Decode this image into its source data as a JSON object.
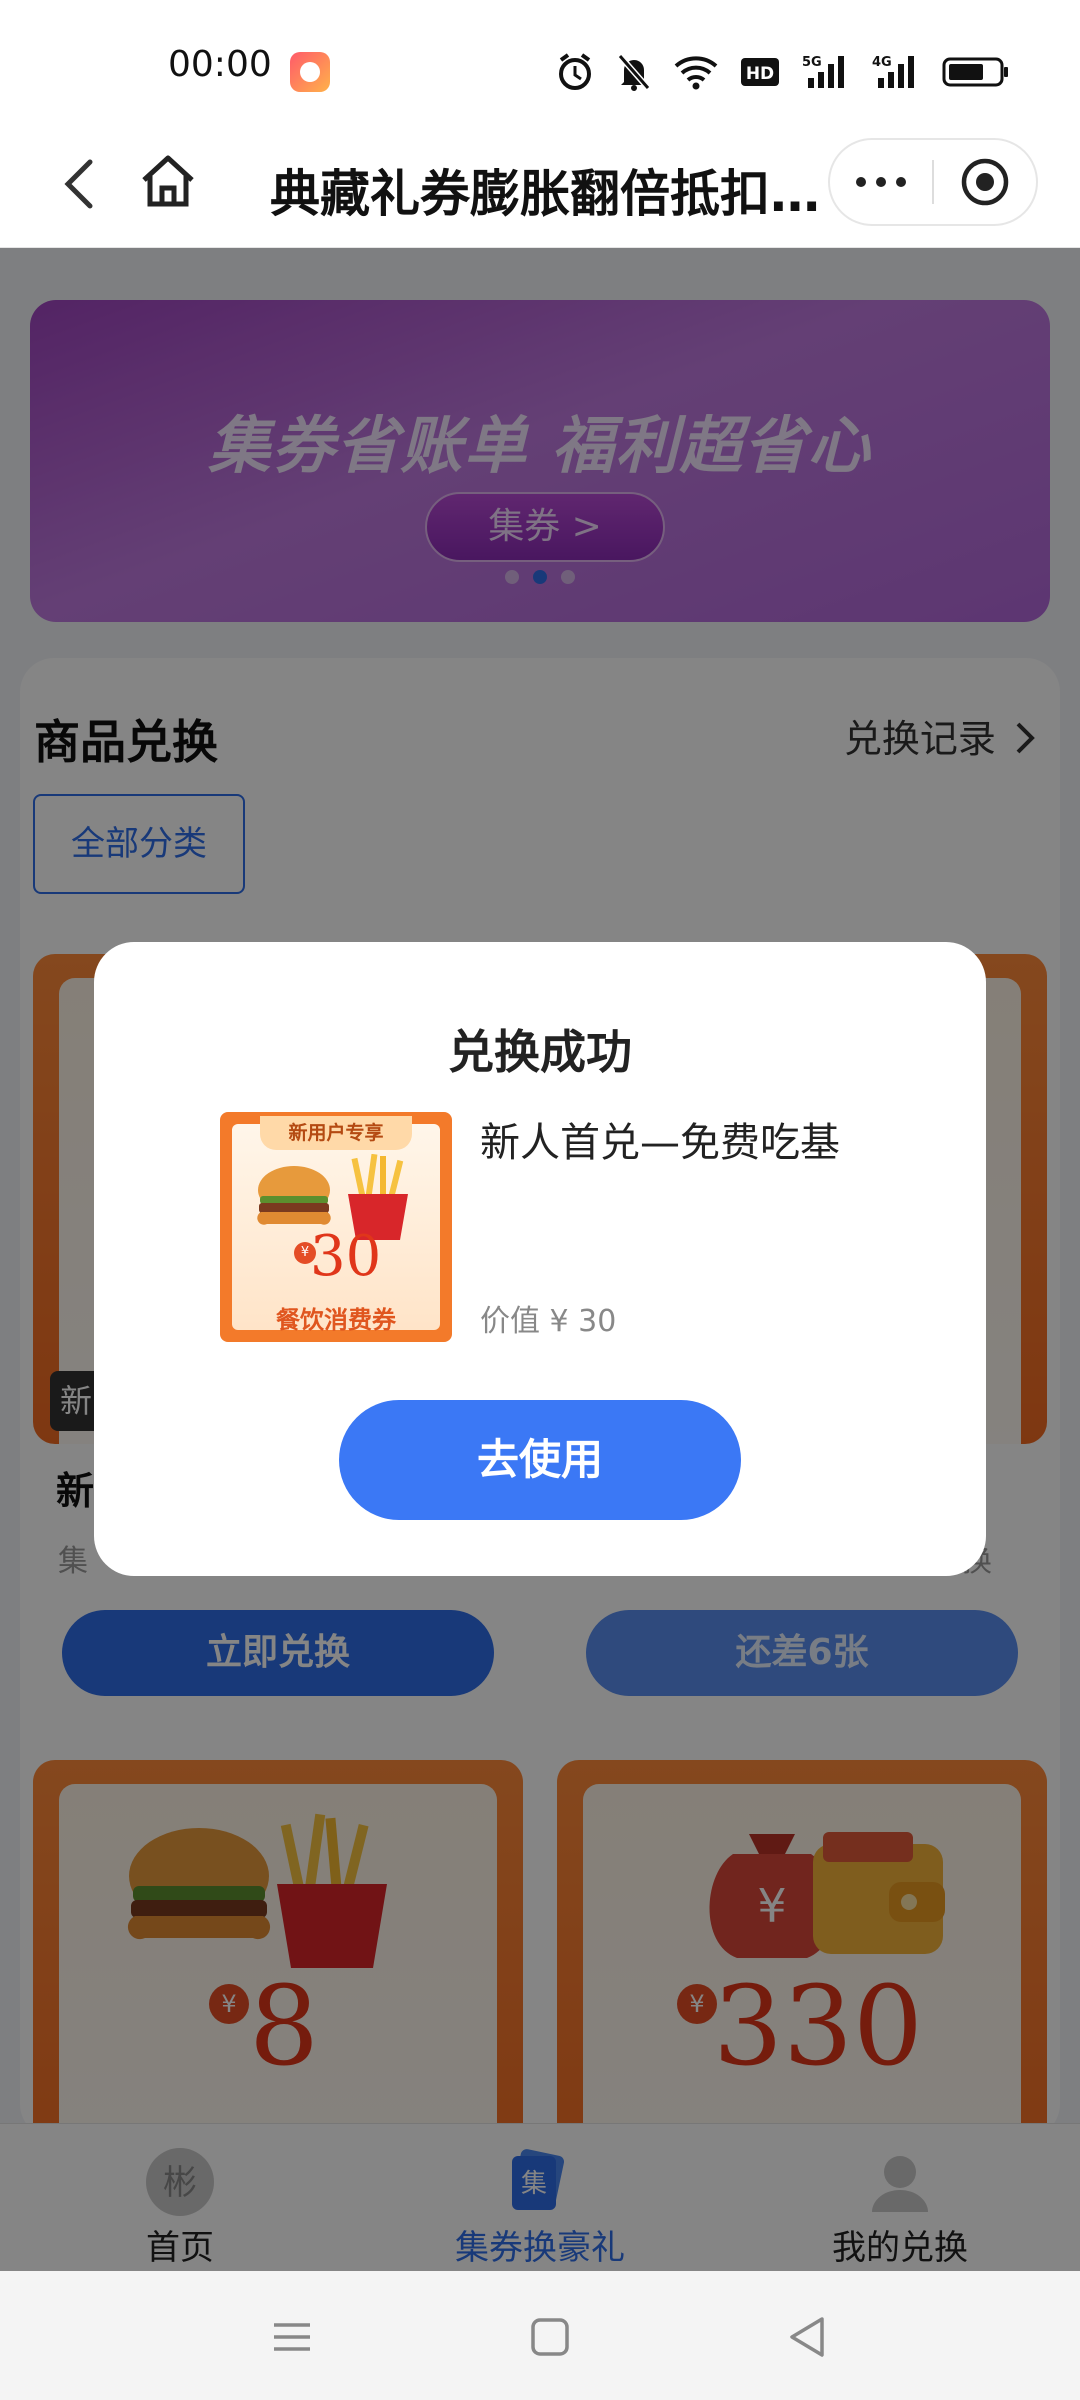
{
  "status_bar": {
    "time": "00:00",
    "icons": [
      "alarm-icon",
      "mute-icon",
      "wifi-icon",
      "hd-icon",
      "5g-signal-icon",
      "4g-signal-icon",
      "battery-icon"
    ],
    "hd_label": "HD",
    "net1": "5G",
    "net2": "4G"
  },
  "nav": {
    "title": "典藏礼券膨胀翻倍抵扣..."
  },
  "banner": {
    "slogan": "集券省账单 福利超省心",
    "button": "集券 >"
  },
  "section": {
    "title": "商品兑换",
    "record_link": "兑换记录",
    "category_button": "全部分类"
  },
  "cards": {
    "left_top": {
      "tag": "新",
      "name": "新",
      "sub": "集",
      "button": "立即兑换"
    },
    "right_top": {
      "sub": "换",
      "button": "还差6张"
    },
    "left_bottom": {
      "price": "8",
      "yen": "¥"
    },
    "right_bottom": {
      "price": "330",
      "yen": "¥"
    }
  },
  "tabs": [
    {
      "label": "首页",
      "icon": "home-tab-icon",
      "badge": "彬"
    },
    {
      "label": "集券换豪礼",
      "icon": "coupon-tab-icon",
      "badge": "集"
    },
    {
      "label": "我的兑换",
      "icon": "user-tab-icon"
    }
  ],
  "modal": {
    "title": "兑换成功",
    "product_name": "新人首兑—免费吃基",
    "value": "价值 ¥ 30",
    "button": "去使用",
    "thumb": {
      "tag": "新用户专享",
      "yen": "¥",
      "price": "30",
      "label": "餐饮消费券"
    }
  },
  "colors": {
    "primary": "#2f6ee8",
    "modal_button": "#3b78f5",
    "coupon_orange": "#f26a22",
    "banner_purple": "#b268da"
  }
}
